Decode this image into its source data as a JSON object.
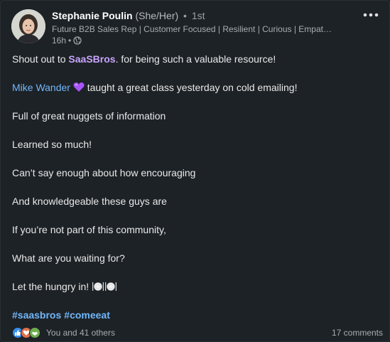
{
  "post": {
    "author": {
      "name": "Stephanie Poulin",
      "pronouns": "(She/Her)",
      "separator": "•",
      "degree": "1st",
      "headline": "Future B2B Sales Rep | Customer Focused | Resilient | Curious | Empat…",
      "time": "16h",
      "time_separator": "•",
      "visibility_icon": "globe-icon"
    },
    "lines": {
      "l1_before": "Shout out to ",
      "l1_mention": "SaaSBros",
      "l1_after": ". for being such a valuable resource!",
      "l2_mention": "Mike Wander",
      "l2_after": " taught a great class yesterday on cold emailing!",
      "l3": "Full of great nuggets of information",
      "l4": "Learned so much!",
      "l5": "Can’t say enough about how encouraging",
      "l6": "And knowledgeable these guys are",
      "l7": "If you’re not part of this community,",
      "l8": "What are you waiting for?",
      "l9": "Let the hungry in! "
    },
    "hashtags": [
      "#saasbros",
      "#comeeat"
    ],
    "reactions_text": "You and 41 others",
    "comments_text": "17 comments",
    "more_icon": "more-horizontal-icon"
  },
  "colors": {
    "background": "#1d2226",
    "link_blue": "#71b7fb",
    "mention_purple": "#c9a5ff",
    "heart_purple": "#a855f7"
  }
}
